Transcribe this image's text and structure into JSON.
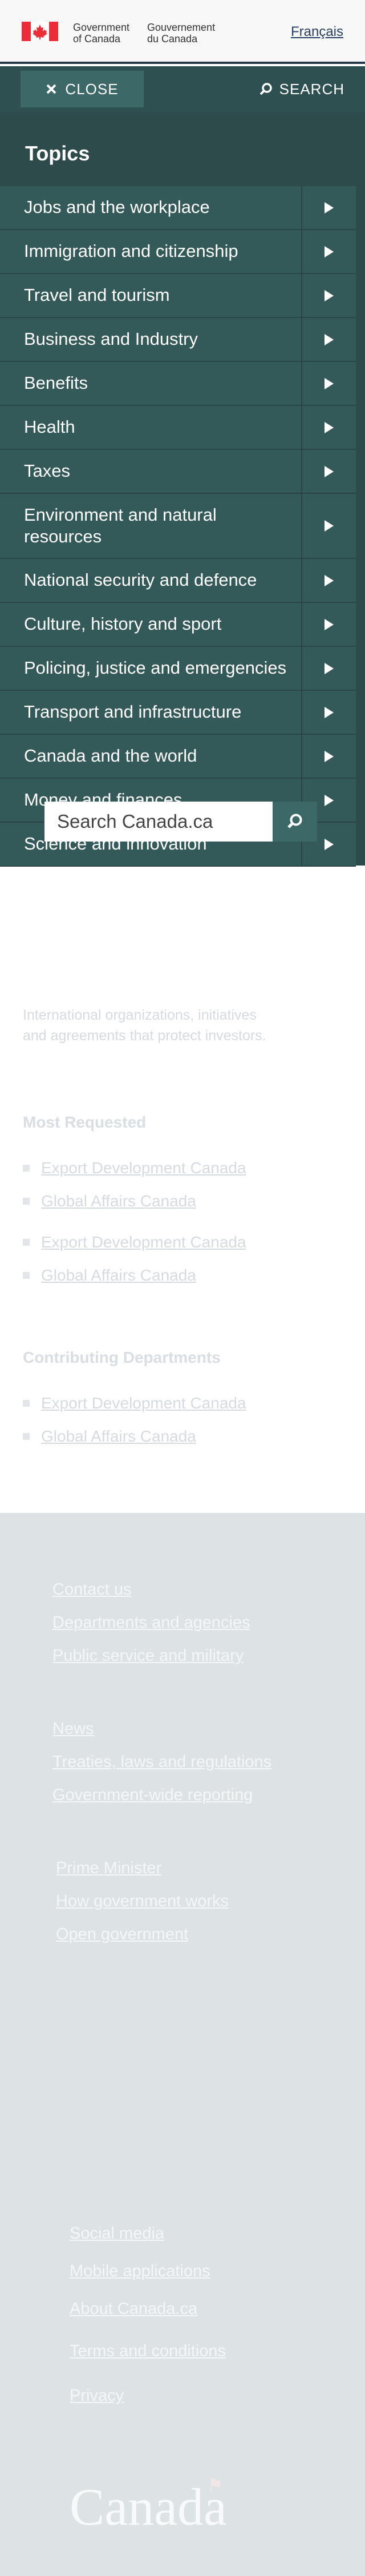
{
  "header": {
    "signature_en": [
      "Government",
      "of Canada"
    ],
    "signature_fr": [
      "Gouvernement",
      "du Canada"
    ],
    "language_link": "Français"
  },
  "menubar": {
    "close_label": "CLOSE",
    "search_label": "SEARCH"
  },
  "topics": {
    "title": "Topics",
    "items": [
      "Jobs and the workplace",
      "Immigration and citizenship",
      "Travel and tourism",
      "Business and Industry",
      "Benefits",
      "Health",
      "Taxes",
      "Environment and natural resources",
      "National security and defence",
      "Culture, history and sport",
      "Policing, justice and emergencies",
      "Transport and infrastructure",
      "Canada and the world",
      "Money and finances",
      "Science and innovation"
    ]
  },
  "search": {
    "placeholder": "Search Canada.ca"
  },
  "faded": {
    "description": [
      "International organizations, initiatives",
      "and agreements that protect investors."
    ],
    "most_requested_heading": "Most Requested",
    "most_requested": [
      "Export Development Canada",
      "Global Affairs Canada",
      "Export Development Canada",
      "Global Affairs Canada"
    ],
    "contributing_heading": "Contributing Departments",
    "contributing": [
      "Export Development Canada",
      "Global Affairs Canada"
    ]
  },
  "footer": {
    "group1": [
      "Contact us",
      "Departments and agencies",
      "Public service and military"
    ],
    "group2": [
      "News",
      "Treaties, laws and regulations",
      "Government-wide reporting"
    ],
    "group3": [
      "Prime Minister",
      "How government works",
      "Open government"
    ],
    "group4": [
      "Social media",
      "Mobile applications",
      "About Canada.ca",
      "Terms and conditions",
      "Privacy"
    ],
    "wordmark": "Canada"
  },
  "colors": {
    "menu_bg": "#2e4b4b",
    "topic_bg": "#335959",
    "accent": "#3d6868",
    "flag_red": "#eb2d37"
  }
}
